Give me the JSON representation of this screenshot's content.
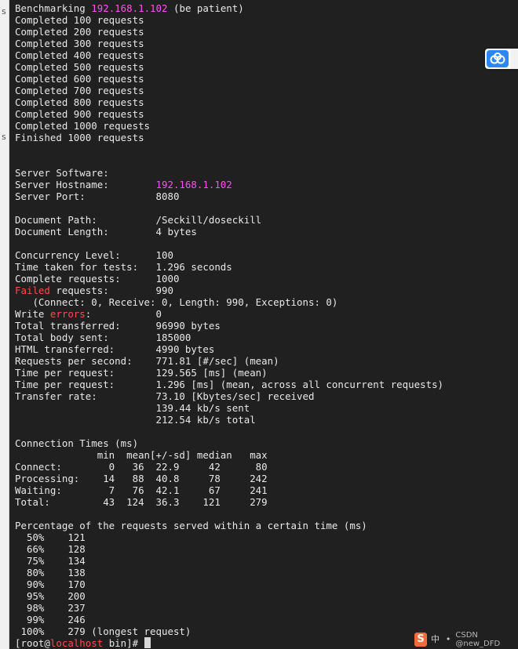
{
  "terminal": {
    "lines": [
      [
        {
          "t": "Benchmarking "
        },
        {
          "t": "192.168.1.102",
          "c": "magenta"
        },
        {
          "t": " (be patient)"
        }
      ],
      [
        {
          "t": "Completed 100 requests"
        }
      ],
      [
        {
          "t": "Completed 200 requests"
        }
      ],
      [
        {
          "t": "Completed 300 requests"
        }
      ],
      [
        {
          "t": "Completed 400 requests"
        }
      ],
      [
        {
          "t": "Completed 500 requests"
        }
      ],
      [
        {
          "t": "Completed 600 requests"
        }
      ],
      [
        {
          "t": "Completed 700 requests"
        }
      ],
      [
        {
          "t": "Completed 800 requests"
        }
      ],
      [
        {
          "t": "Completed 900 requests"
        }
      ],
      [
        {
          "t": "Completed 1000 requests"
        }
      ],
      [
        {
          "t": "Finished 1000 requests"
        }
      ],
      [],
      [],
      [
        {
          "t": "Server Software:"
        }
      ],
      [
        {
          "t": "Server Hostname:        "
        },
        {
          "t": "192.168.1.102",
          "c": "magenta"
        }
      ],
      [
        {
          "t": "Server Port:            8080"
        }
      ],
      [],
      [
        {
          "t": "Document Path:          /Seckill/doseckill"
        }
      ],
      [
        {
          "t": "Document Length:        4 bytes"
        }
      ],
      [],
      [
        {
          "t": "Concurrency Level:      100"
        }
      ],
      [
        {
          "t": "Time taken for tests:   1.296 seconds"
        }
      ],
      [
        {
          "t": "Complete requests:      1000"
        }
      ],
      [
        {
          "t": "Failed",
          "c": "red"
        },
        {
          "t": " requests:        990"
        }
      ],
      [
        {
          "t": "   (Connect: 0, Receive: 0, Length: 990, Exceptions: 0)"
        }
      ],
      [
        {
          "t": "Write "
        },
        {
          "t": "errors",
          "c": "red"
        },
        {
          "t": ":           0"
        }
      ],
      [
        {
          "t": "Total transferred:      96990 bytes"
        }
      ],
      [
        {
          "t": "Total body sent:        185000"
        }
      ],
      [
        {
          "t": "HTML transferred:       4990 bytes"
        }
      ],
      [
        {
          "t": "Requests per second:    771.81 [#/sec] (mean)"
        }
      ],
      [
        {
          "t": "Time per request:       129.565 [ms] (mean)"
        }
      ],
      [
        {
          "t": "Time per request:       1.296 [ms] (mean, across all concurrent requests)"
        }
      ],
      [
        {
          "t": "Transfer rate:          73.10 [Kbytes/sec] received"
        }
      ],
      [
        {
          "t": "                        139.44 kb/s sent"
        }
      ],
      [
        {
          "t": "                        212.54 kb/s total"
        }
      ],
      [],
      [
        {
          "t": "Connection Times (ms)"
        }
      ],
      [
        {
          "t": "              min  mean[+/-sd] median   max"
        }
      ],
      [
        {
          "t": "Connect:        0   36  22.9     42      80"
        }
      ],
      [
        {
          "t": "Processing:    14   88  40.8     78     242"
        }
      ],
      [
        {
          "t": "Waiting:        7   76  42.1     67     241"
        }
      ],
      [
        {
          "t": "Total:         43  124  36.3    121     279"
        }
      ],
      [],
      [
        {
          "t": "Percentage of the requests served within a certain time (ms)"
        }
      ],
      [
        {
          "t": "  50%    121"
        }
      ],
      [
        {
          "t": "  66%    128"
        }
      ],
      [
        {
          "t": "  75%    134"
        }
      ],
      [
        {
          "t": "  80%    138"
        }
      ],
      [
        {
          "t": "  90%    170"
        }
      ],
      [
        {
          "t": "  95%    200"
        }
      ],
      [
        {
          "t": "  98%    237"
        }
      ],
      [
        {
          "t": "  99%    246"
        }
      ],
      [
        {
          "t": " 100%    279 (longest request)"
        }
      ]
    ],
    "prompt": [
      {
        "t": "[root@"
      },
      {
        "t": "localhost",
        "c": "red"
      },
      {
        "t": " bin]# "
      }
    ]
  },
  "gutter_marks": [
    "s",
    "s"
  ],
  "widgets": {
    "cloud_icon": "cloud-icon",
    "tray_logo": "S",
    "tray_text": "CSDN @new_DFD",
    "tray_icons": [
      "中",
      "•",
      "♪",
      "✎"
    ]
  },
  "colors": {
    "background": "#202020",
    "foreground": "#e8e8e8",
    "magenta": "#ff4ef7",
    "red": "#ff4a4a"
  }
}
